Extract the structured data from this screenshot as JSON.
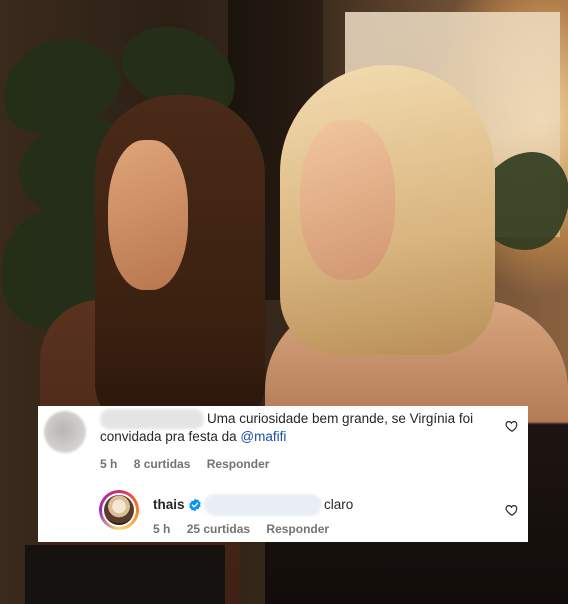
{
  "comment": {
    "text": "Uma curiosidade bem grande, se Virgínia foi convidada pra festa da",
    "mention": "@mafifi",
    "time": "5 h",
    "likes": "8 curtidas",
    "reply_label": "Responder"
  },
  "reply": {
    "username": "thais",
    "text": "claro",
    "time": "5 h",
    "likes": "25 curtidas",
    "reply_label": "Responder"
  },
  "colors": {
    "mention": "#1a4fa3",
    "verified": "#0095f6",
    "meta": "#737373"
  },
  "icons": [
    "heart-icon",
    "verified-badge-icon"
  ]
}
